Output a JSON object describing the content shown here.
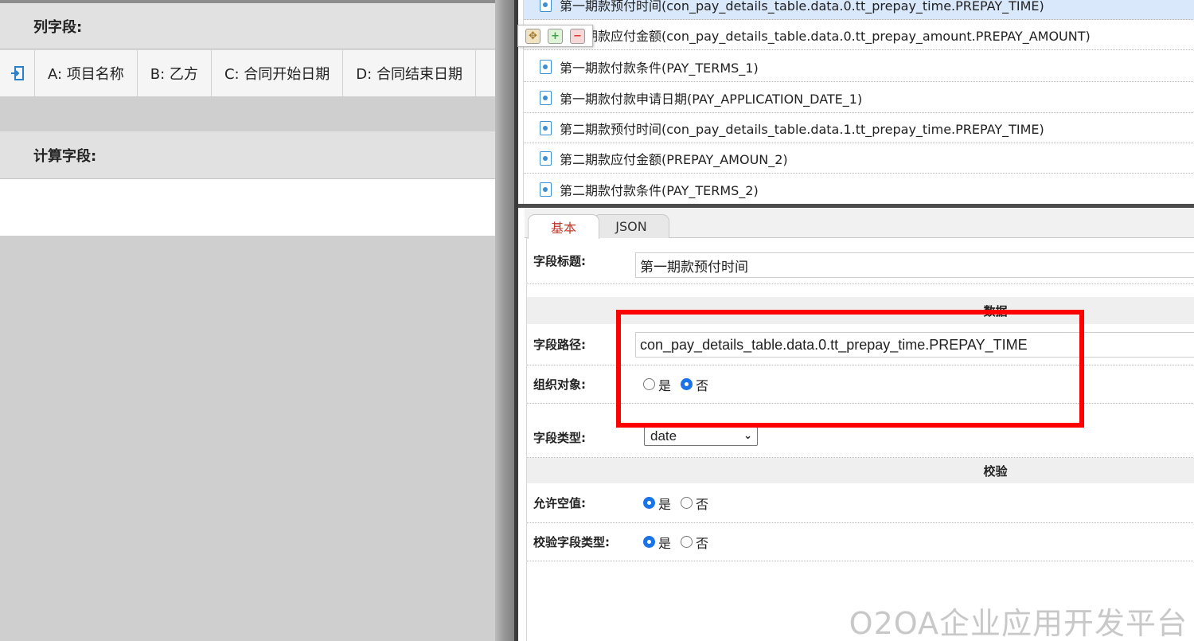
{
  "left_panel": {
    "column_fields_title": "列字段:",
    "columns": [
      {
        "label": "A: 项目名称"
      },
      {
        "label": "B: 乙方"
      },
      {
        "label": "C: 合同开始日期"
      },
      {
        "label": "D: 合同结束日期"
      }
    ],
    "calc_fields_title": "计算字段:"
  },
  "field_list": {
    "items": [
      {
        "label": "第一期款预付时间(con_pay_details_table.data.0.tt_prepay_time.PREPAY_TIME)"
      },
      {
        "label": "第一期款应付金额(con_pay_details_table.data.0.tt_prepay_amount.PREPAY_AMOUNT)"
      },
      {
        "label": "第一期款付款条件(PAY_TERMS_1)"
      },
      {
        "label": "第一期款付款申请日期(PAY_APPLICATION_DATE_1)"
      },
      {
        "label": "第二期款预付时间(con_pay_details_table.data.1.tt_prepay_time.PREPAY_TIME)"
      },
      {
        "label": "第二期款应付金额(PREPAY_AMOUN_2)"
      },
      {
        "label": "第二期款付款条件(PAY_TERMS_2)"
      }
    ],
    "selected_index": 0,
    "toolbar": {
      "move_icon": "move-icon",
      "add_icon": "add-icon",
      "remove_icon": "remove-icon"
    }
  },
  "tabs": {
    "basic": "基本",
    "json": "JSON",
    "active": "基本"
  },
  "properties": {
    "field_title_label": "字段标题:",
    "field_title_value": "第一期款预付时间",
    "data_group": "数据",
    "field_path_label": "字段路径:",
    "field_path_value": "con_pay_details_table.data.0.tt_prepay_time.PREPAY_TIME",
    "org_object_label": "组织对象:",
    "org_object_options": {
      "yes": "是",
      "no": "否",
      "selected": "否"
    },
    "field_type_label": "字段类型:",
    "field_type_value": "date",
    "validation_group": "校验",
    "allow_empty_label": "允许空值:",
    "allow_empty_options": {
      "yes": "是",
      "no": "否",
      "selected": "是"
    },
    "validate_type_label": "校验字段类型:",
    "validate_type_options": {
      "yes": "是",
      "no": "否",
      "selected": "是"
    }
  },
  "highlight_color": "#ff0000",
  "accent_color": "#1a73e8",
  "watermark": "O2OA企业应用开发平台"
}
